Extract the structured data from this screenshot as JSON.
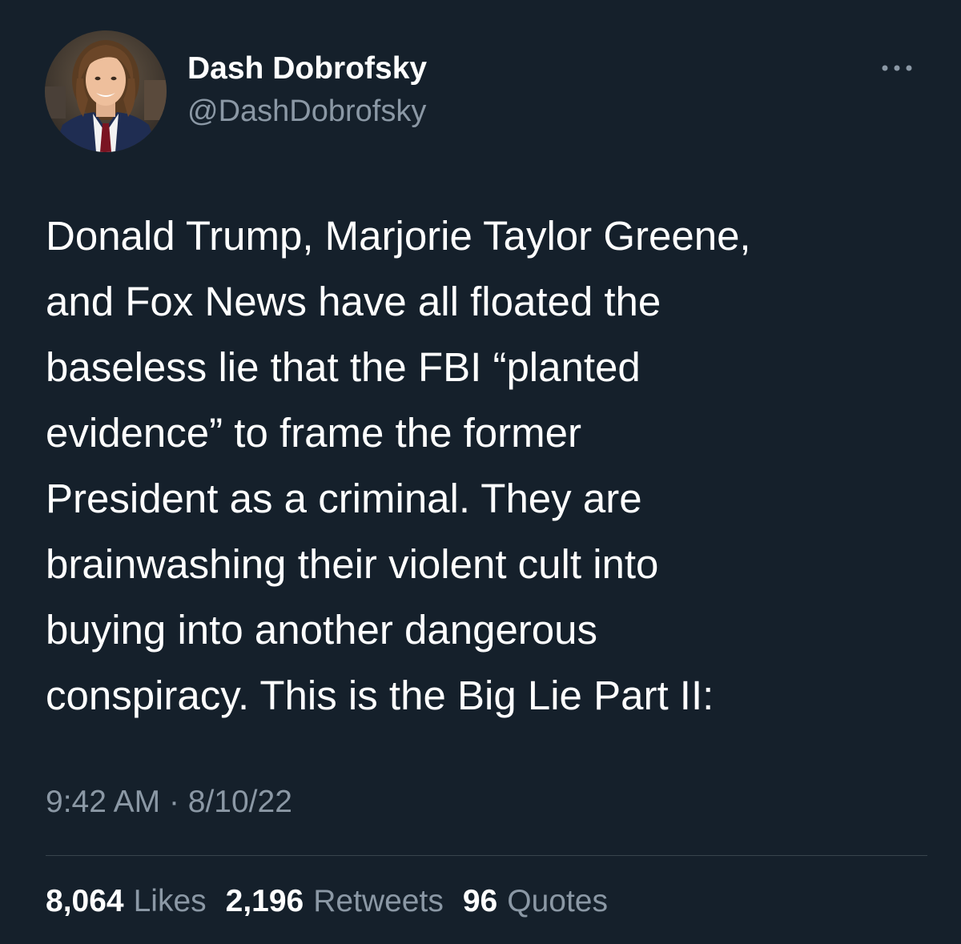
{
  "tweet": {
    "author": {
      "display_name": "Dash Dobrofsky",
      "handle": "@DashDobrofsky"
    },
    "more_icon": "ellipsis-icon",
    "text": "Donald Trump, Marjorie Taylor Greene,\nand Fox News have all floated the\nbaseless lie that the FBI “planted\nevidence” to frame the former\nPresident as a criminal. They are\nbrainwashing their violent cult into\nbuying into another dangerous\nconspiracy. This is the Big Lie Part II:",
    "time": "9:42 AM",
    "separator": "·",
    "date": "8/10/22",
    "stats": {
      "likes": {
        "count": "8,064",
        "label": "Likes"
      },
      "retweets": {
        "count": "2,196",
        "label": "Retweets"
      },
      "quotes": {
        "count": "96",
        "label": "Quotes"
      }
    }
  },
  "colors": {
    "background": "#15202b",
    "primary_text": "#ffffff",
    "secondary_text": "#8b98a5",
    "divider": "#38444d"
  }
}
